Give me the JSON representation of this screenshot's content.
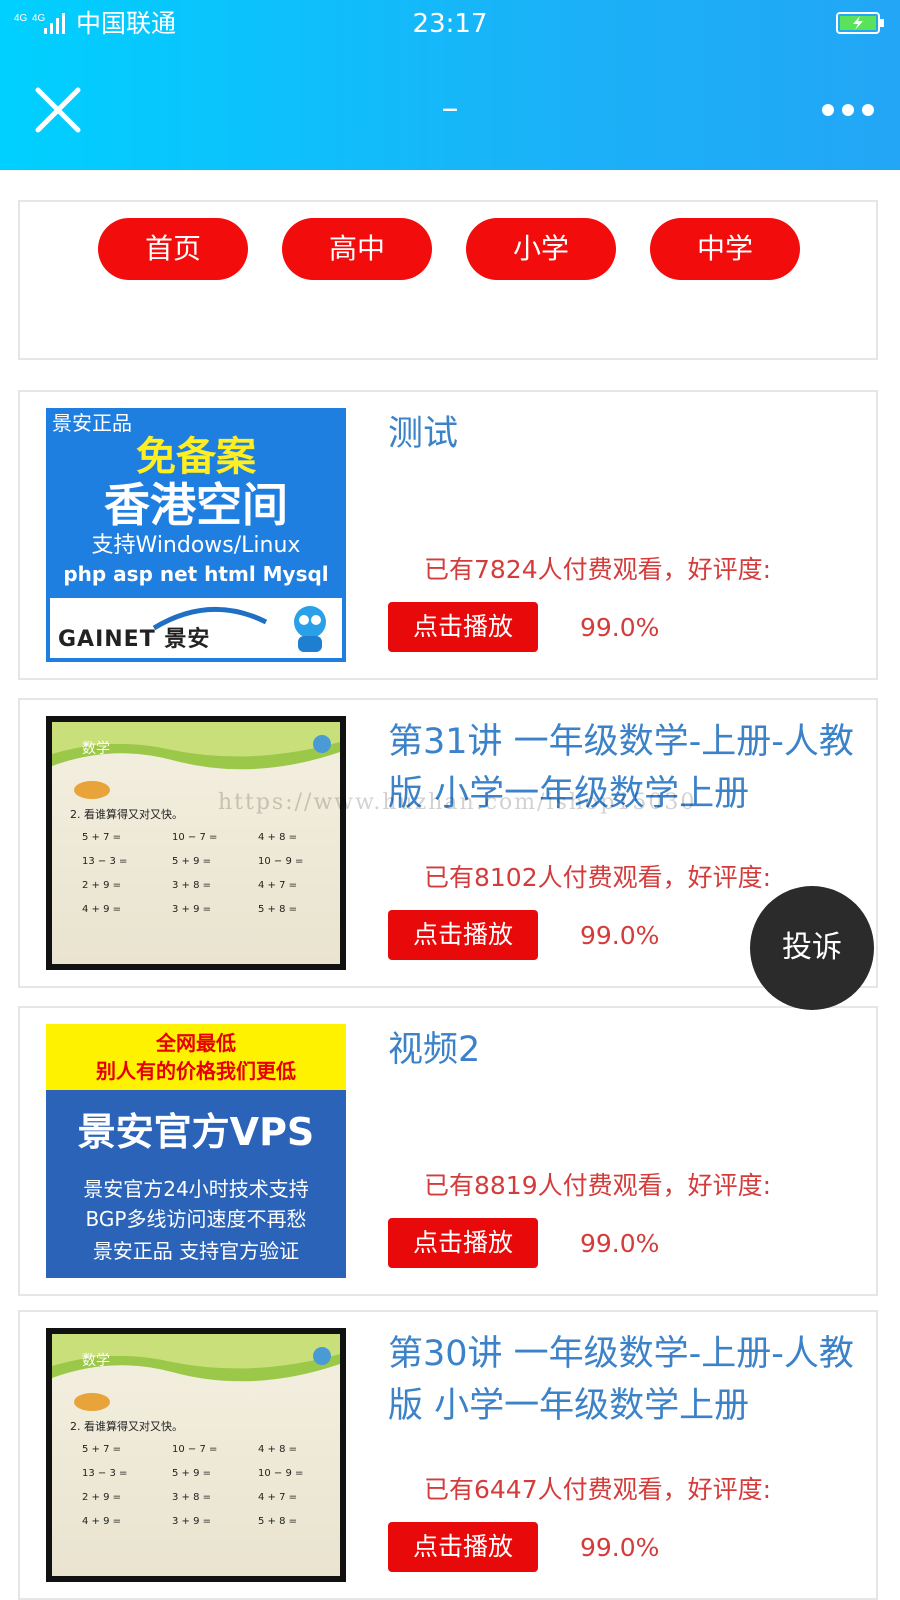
{
  "status_bar": {
    "network": "4G 4G",
    "carrier": "中国联通",
    "time": "23:17"
  },
  "nav": {
    "title": "–"
  },
  "categories": [
    "首页",
    "高中",
    "小学",
    "中学"
  ],
  "videos": [
    {
      "title": "测试",
      "stats": "已有7824人付费观看，好评度:",
      "rating": "99.0%",
      "play_label": "点击播放",
      "thumb": {
        "brand": "景安正品",
        "headline1": "免备案",
        "headline2": "香港空间",
        "line3": "支持Windows/Linux",
        "line4": "php asp net html Mysql",
        "logo": "GAINET 景安"
      }
    },
    {
      "title": "第31讲 一年级数学-上册-人教版 小学一年级数学上册",
      "stats": "已有8102人付费观看，好评度:",
      "rating": "99.0%",
      "play_label": "点击播放",
      "thumb": {
        "lesson": "数学",
        "question": "2. 看谁算得又对又快。",
        "cells": [
          "5 + 7 =",
          "10 − 7 =",
          "4 + 8 =",
          "13 − 3 =",
          "5 + 9 =",
          "10 − 9 =",
          "2 + 9 =",
          "3 + 8 =",
          "4 + 7 =",
          "4 + 9 =",
          "3 + 9 =",
          "5 + 8 ="
        ]
      }
    },
    {
      "title": "视频2",
      "stats": "已有8819人付费观看，好评度:",
      "rating": "99.0%",
      "play_label": "点击播放",
      "thumb": {
        "line1": "全网最低",
        "line2": "别人有的价格我们更低",
        "line3": "景安官方VPS",
        "line4": "景安官方24小时技术支持",
        "line5": "BGP多线访问速度不再愁",
        "line6": "景安正品 支持官方验证"
      }
    },
    {
      "title": "第30讲 一年级数学-上册-人教版 小学一年级数学上册",
      "stats": "已有6447人付费观看，好评度:",
      "rating": "99.0%",
      "play_label": "点击播放",
      "thumb": {
        "lesson": "数学",
        "question": "2. 看谁算得又对又快。",
        "cells": [
          "5 + 7 =",
          "10 − 7 =",
          "4 + 8 =",
          "13 − 3 =",
          "5 + 9 =",
          "10 − 9 =",
          "2 + 9 =",
          "3 + 8 =",
          "4 + 7 =",
          "4 + 9 =",
          "3 + 9 =",
          "5 + 8 ="
        ]
      }
    }
  ],
  "complain_label": "投诉",
  "watermark": "https://www.huzhan.com/ishop15030"
}
